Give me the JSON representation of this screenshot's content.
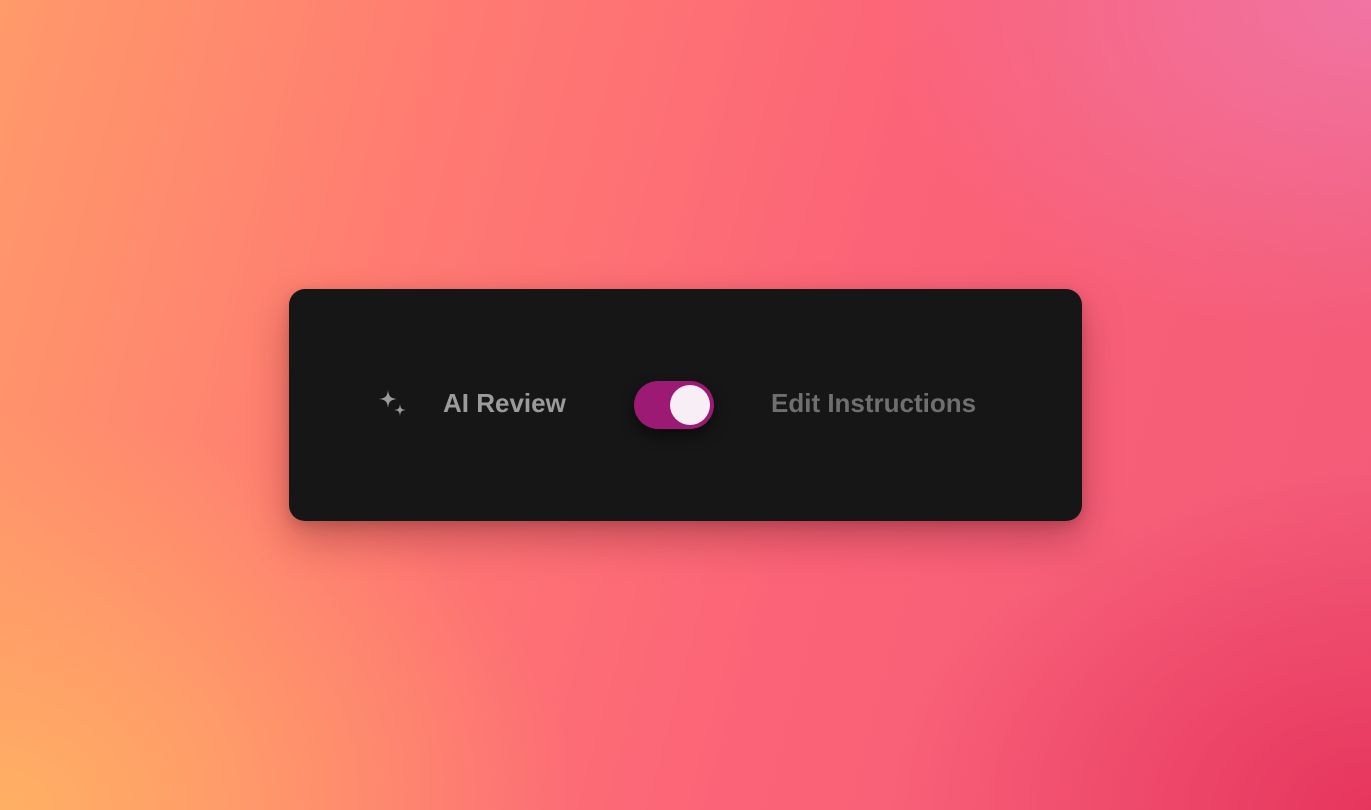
{
  "card": {
    "left_label": "AI Review",
    "right_label": "Edit Instructions",
    "icon": "sparkles-icon",
    "toggle": {
      "state": "on",
      "track_color": "#9c1a73",
      "knob_color": "#f8eef6"
    }
  },
  "colors": {
    "card_background": "#161616",
    "left_label": "#9b9b9b",
    "right_label": "#6f6f6f"
  }
}
